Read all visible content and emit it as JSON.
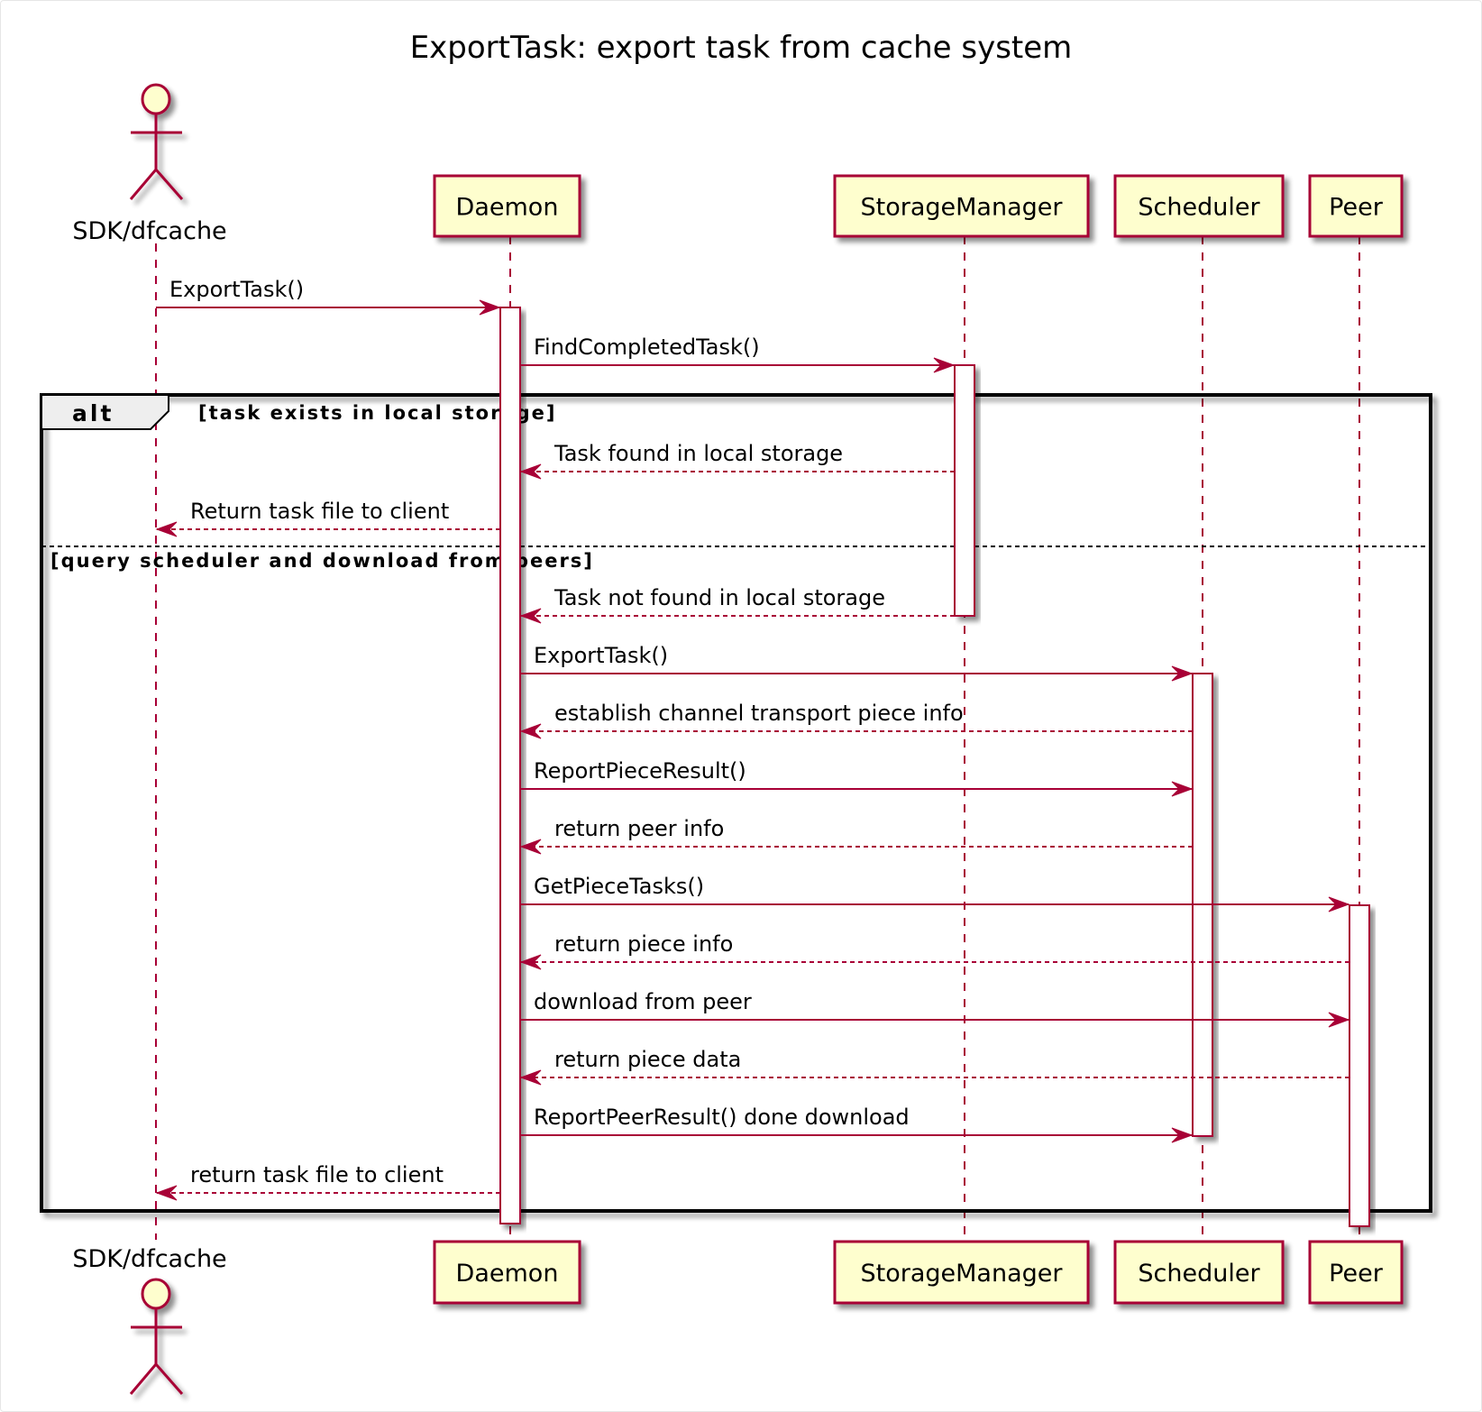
{
  "title": "ExportTask: export task from cache system",
  "colors": {
    "line": "#a80036",
    "participant_fill": "#fefece",
    "frame": "#000000",
    "alt_tab_fill": "#eeeeee"
  },
  "participants": [
    {
      "id": "sdk",
      "label": "SDK/dfcache",
      "kind": "actor",
      "icon": "actor-icon"
    },
    {
      "id": "daemon",
      "label": "Daemon",
      "kind": "participant"
    },
    {
      "id": "storage",
      "label": "StorageManager",
      "kind": "participant"
    },
    {
      "id": "scheduler",
      "label": "Scheduler",
      "kind": "participant"
    },
    {
      "id": "peer",
      "label": "Peer",
      "kind": "participant"
    }
  ],
  "messages": [
    {
      "from": "sdk",
      "to": "daemon",
      "label": "ExportTask()",
      "style": "sync"
    },
    {
      "from": "daemon",
      "to": "storage",
      "label": "FindCompletedTask()",
      "style": "sync"
    },
    {
      "from": "storage",
      "to": "daemon",
      "label": "Task found in local storage",
      "style": "return"
    },
    {
      "from": "daemon",
      "to": "sdk",
      "label": "Return task file to client",
      "style": "return"
    },
    {
      "from": "storage",
      "to": "daemon",
      "label": "Task not found in local storage",
      "style": "return"
    },
    {
      "from": "daemon",
      "to": "scheduler",
      "label": "ExportTask()",
      "style": "sync"
    },
    {
      "from": "scheduler",
      "to": "daemon",
      "label": "establish channel transport piece info",
      "style": "return"
    },
    {
      "from": "daemon",
      "to": "scheduler",
      "label": "ReportPieceResult()",
      "style": "sync"
    },
    {
      "from": "scheduler",
      "to": "daemon",
      "label": "return peer info",
      "style": "return"
    },
    {
      "from": "daemon",
      "to": "peer",
      "label": "GetPieceTasks()",
      "style": "sync"
    },
    {
      "from": "peer",
      "to": "daemon",
      "label": "return piece info",
      "style": "return"
    },
    {
      "from": "daemon",
      "to": "peer",
      "label": "download from peer",
      "style": "sync"
    },
    {
      "from": "peer",
      "to": "daemon",
      "label": "return piece data",
      "style": "return"
    },
    {
      "from": "daemon",
      "to": "scheduler",
      "label": "ReportPeerResult() done download",
      "style": "sync"
    },
    {
      "from": "daemon",
      "to": "sdk",
      "label": "return task file to client",
      "style": "return"
    }
  ],
  "alt_group": {
    "keyword": "alt",
    "guards": [
      "[task exists in local storage]",
      "[query scheduler and download from peers]"
    ]
  }
}
